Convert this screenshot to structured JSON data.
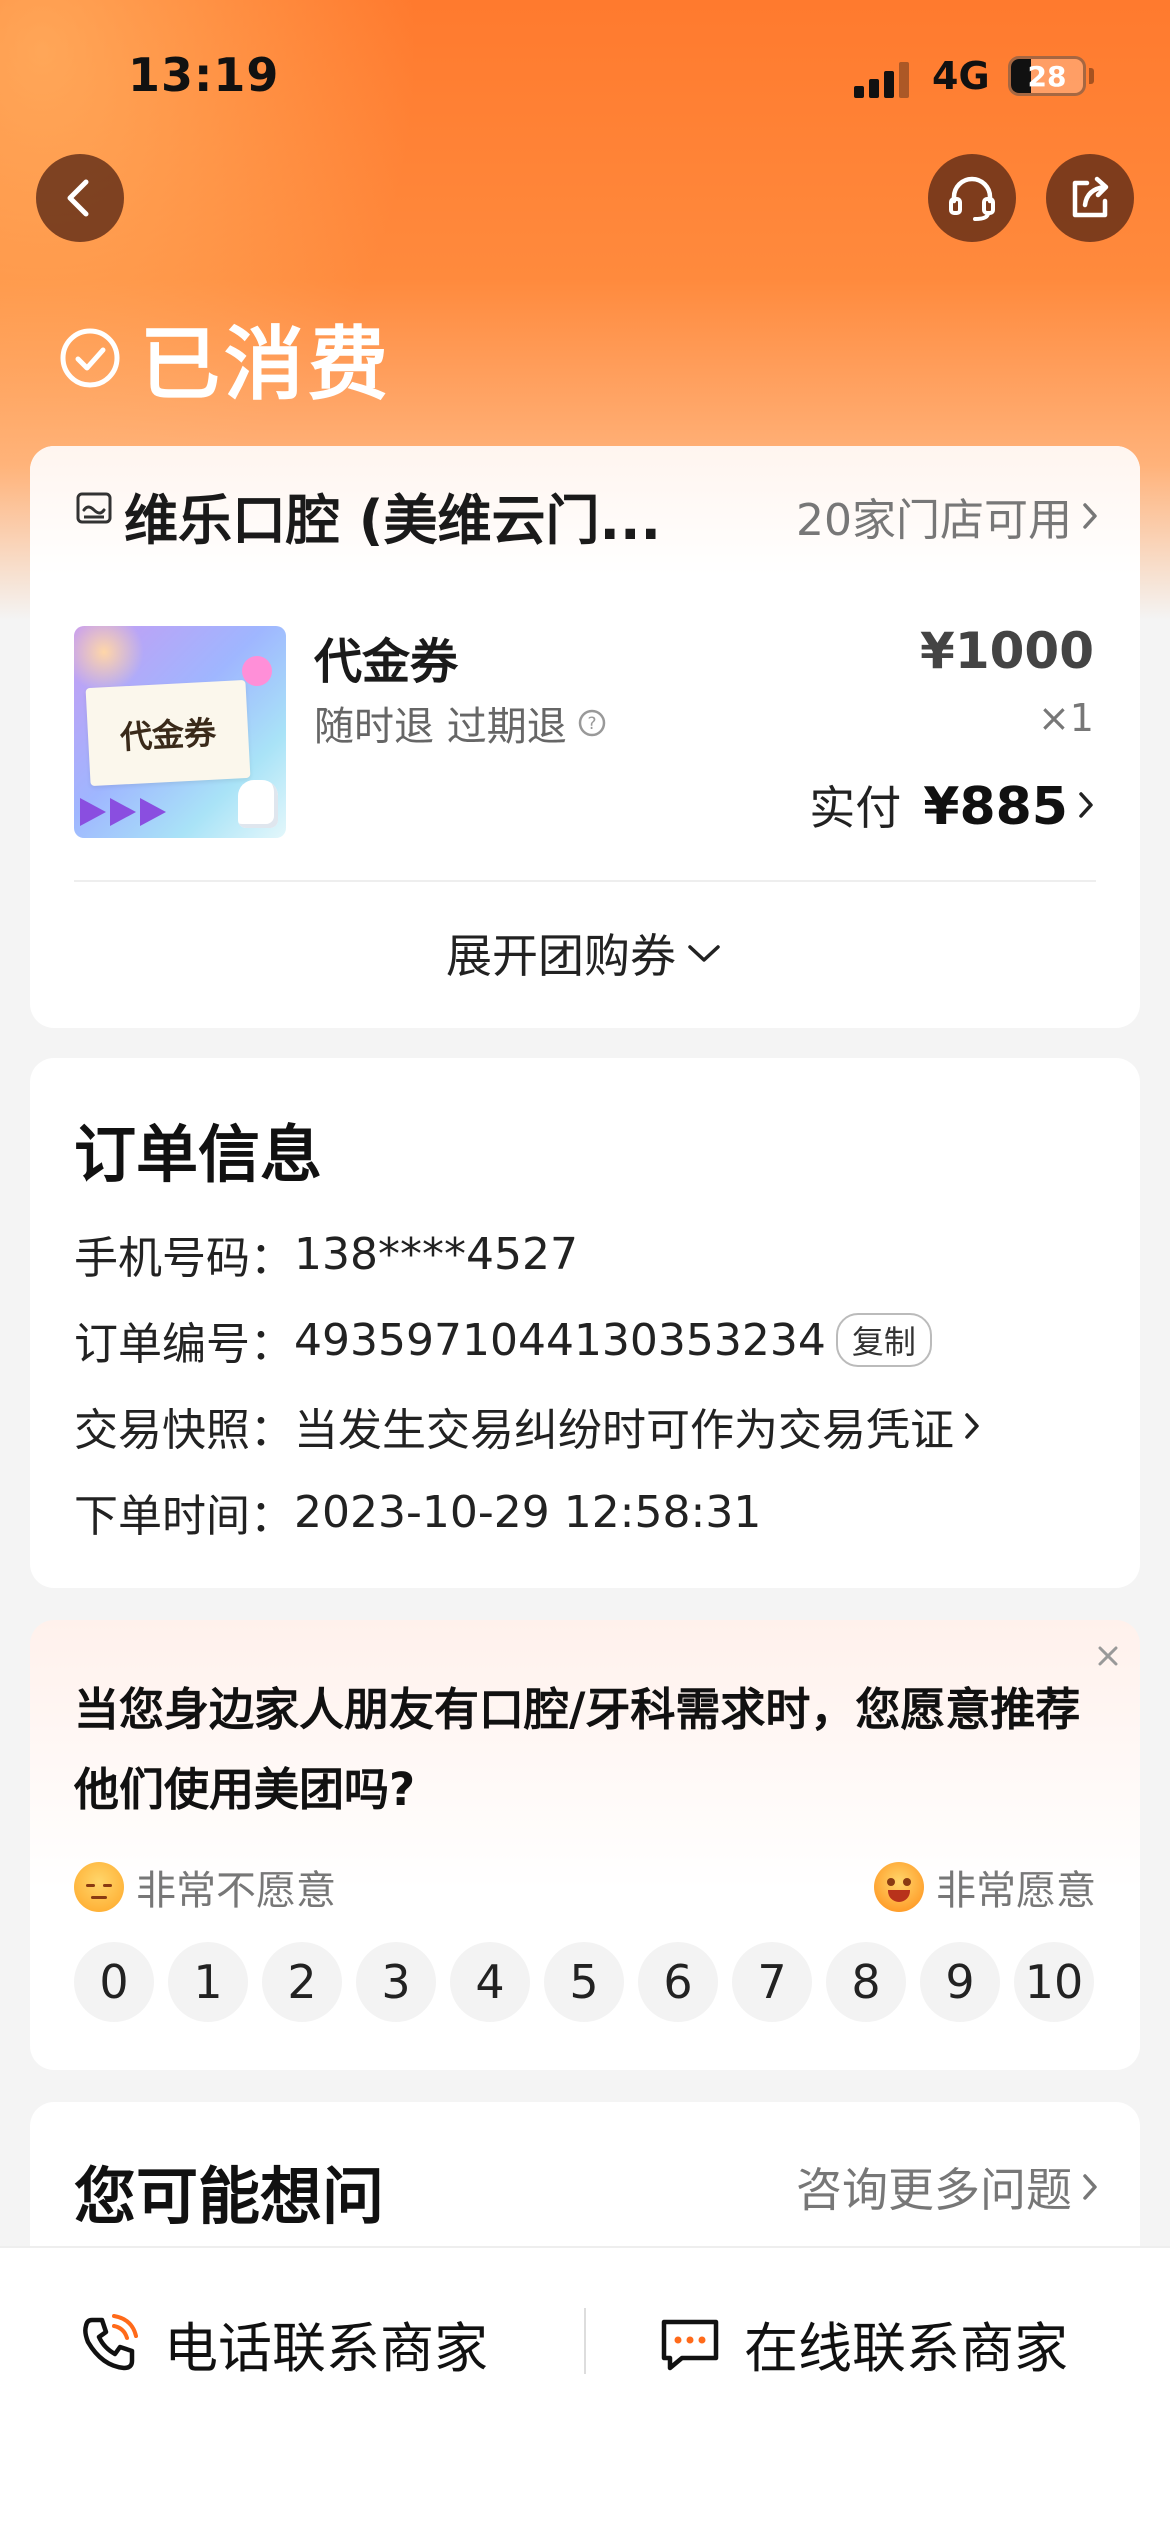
{
  "status_bar": {
    "time": "13:19",
    "network": "4G",
    "battery": "28",
    "battery_level": 0.28
  },
  "nav": {
    "back_icon": "chevron-left-icon",
    "service_icon": "headset-icon",
    "share_icon": "share-icon"
  },
  "order_status": {
    "label": "已消费",
    "icon": "check-circle-icon"
  },
  "product_card": {
    "shop_name": "维乐口腔 (美维云门...",
    "stores_available": "20家门店可用",
    "thumbnail_text": "代金券",
    "product_name": "代金券",
    "refund_policy": "随时退 过期退",
    "price": "¥1000",
    "quantity": "×1",
    "paid_label": "实付",
    "paid_value": "¥885",
    "expand_label": "展开团购券"
  },
  "order_info": {
    "title": "订单信息",
    "rows": [
      {
        "label": "手机号码：",
        "value": "138****4527"
      },
      {
        "label": "订单编号：",
        "value": "4935971044130353234",
        "action": "复制"
      },
      {
        "label": "交易快照：",
        "value": "当发生交易纠纷时可作为交易凭证"
      },
      {
        "label": "下单时间：",
        "value": "2023-10-29 12:58:31"
      }
    ]
  },
  "survey": {
    "question": "当您身边家人朋友有口腔/牙科需求时，您愿意推荐他们使用美团吗?",
    "low_label": "非常不愿意",
    "high_label": "非常愿意",
    "scale": [
      "0",
      "1",
      "2",
      "3",
      "4",
      "5",
      "6",
      "7",
      "8",
      "9",
      "10"
    ]
  },
  "faq": {
    "title": "您可能想问",
    "more": "咨询更多问题"
  },
  "bottom_bar": {
    "phone_label": "电话联系商家",
    "online_label": "在线联系商家"
  },
  "colors": {
    "brand_orange": "#ff7a2e",
    "text_primary": "#111111",
    "text_secondary": "#777777"
  }
}
